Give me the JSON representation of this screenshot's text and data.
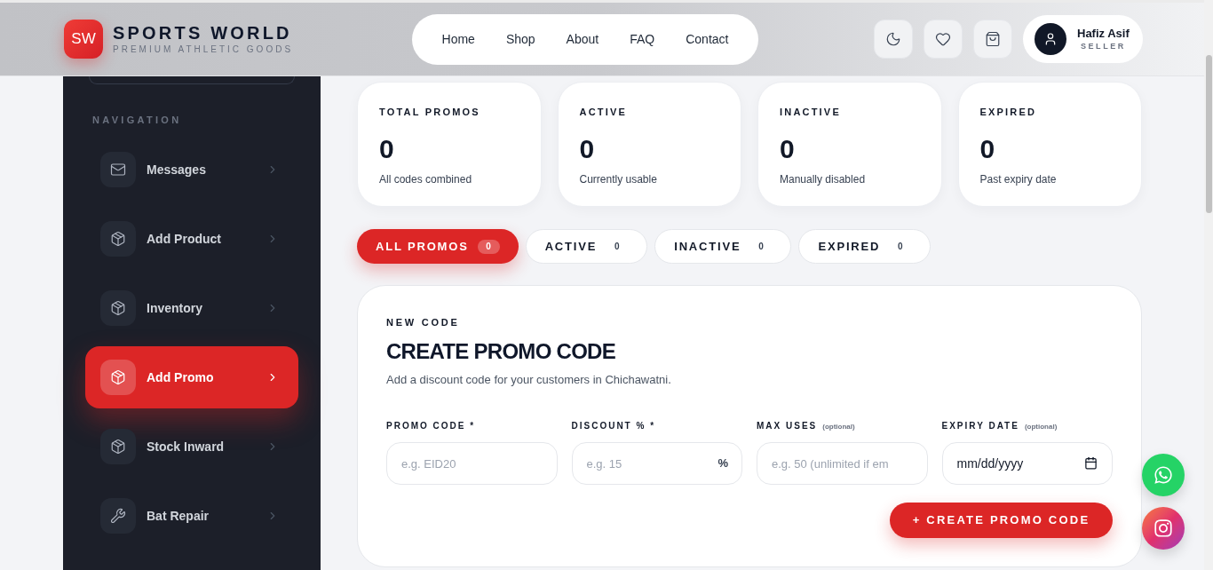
{
  "brand": {
    "logo_text": "SW",
    "name": "SPORTS WORLD",
    "tagline": "PREMIUM ATHLETIC GOODS"
  },
  "nav": {
    "links": [
      "Home",
      "Shop",
      "About",
      "FAQ",
      "Contact"
    ]
  },
  "user": {
    "name": "Hafiz Asif",
    "role": "SELLER"
  },
  "sidebar": {
    "heading": "NAVIGATION",
    "items": [
      {
        "label": "Messages",
        "selected": false
      },
      {
        "label": "Add Product",
        "selected": false
      },
      {
        "label": "Inventory",
        "selected": false
      },
      {
        "label": "Add Promo",
        "selected": true
      },
      {
        "label": "Stock Inward",
        "selected": false
      },
      {
        "label": "Bat Repair",
        "selected": false
      }
    ]
  },
  "stats": [
    {
      "label": "TOTAL PROMOS",
      "value": "0",
      "caption": "All codes combined"
    },
    {
      "label": "ACTIVE",
      "value": "0",
      "caption": "Currently usable"
    },
    {
      "label": "INACTIVE",
      "value": "0",
      "caption": "Manually disabled"
    },
    {
      "label": "EXPIRED",
      "value": "0",
      "caption": "Past expiry date"
    }
  ],
  "filter_tabs": [
    {
      "label": "ALL PROMOS",
      "count": "0",
      "selected": true
    },
    {
      "label": "ACTIVE",
      "count": "0",
      "selected": false
    },
    {
      "label": "INACTIVE",
      "count": "0",
      "selected": false
    },
    {
      "label": "EXPIRED",
      "count": "0",
      "selected": false
    }
  ],
  "form": {
    "eyebrow": "NEW CODE",
    "title": "CREATE PROMO CODE",
    "description": "Add a discount code for your customers in Chichawatni.",
    "fields": [
      {
        "kind": "text",
        "label": "PROMO CODE *",
        "placeholder": "e.g. EID20"
      },
      {
        "kind": "number",
        "label": "DISCOUNT % *",
        "placeholder": "e.g. 15",
        "suffix": "%"
      },
      {
        "kind": "number",
        "label": "MAX USES",
        "hint": "(optional)",
        "placeholder": "e.g. 50 (unlimited if em"
      },
      {
        "kind": "date",
        "label": "EXPIRY DATE",
        "hint": "(optional)",
        "placeholder": "mm/dd/yyyy"
      }
    ],
    "submit": "+ CREATE PROMO CODE"
  }
}
